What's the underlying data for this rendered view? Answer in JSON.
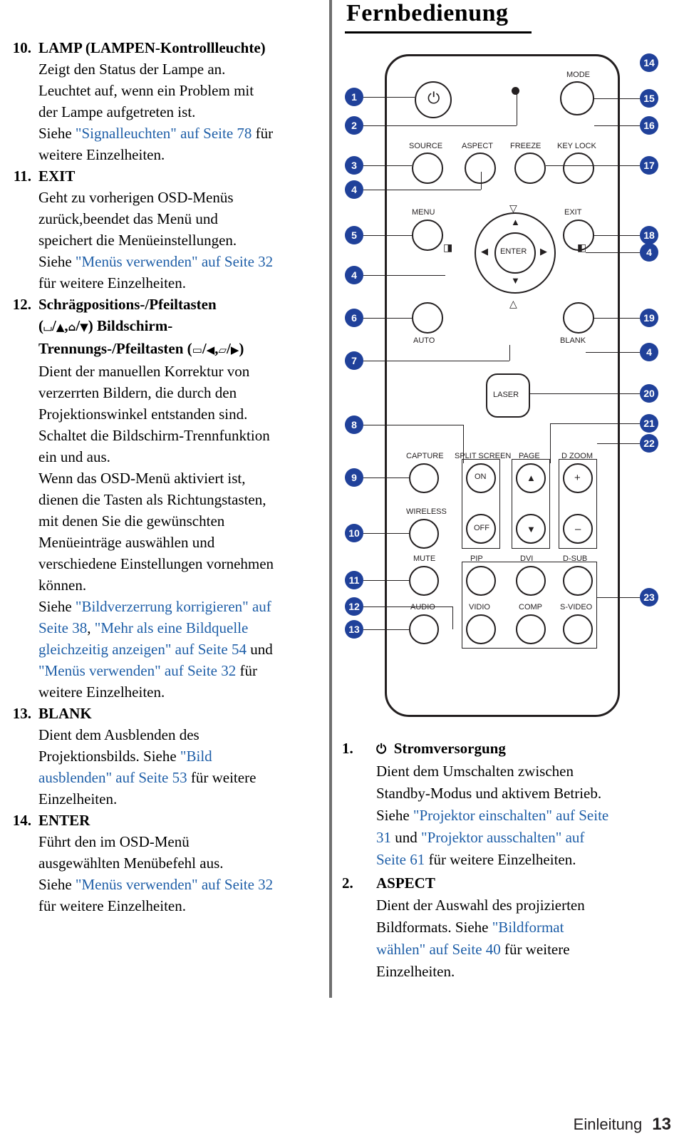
{
  "left_items": [
    {
      "num": "10.",
      "head": "LAMP (LAMPEN-Kontrollleuchte)",
      "lines": [
        {
          "text": "Zeigt den Status der Lampe an."
        },
        {
          "text": "Leuchtet auf, wenn ein Problem mit"
        },
        {
          "text": "der Lampe aufgetreten ist."
        },
        {
          "pre": "Siehe ",
          "link": "\"Signalleuchten\" auf Seite 78",
          "post": " für"
        },
        {
          "text": "weitere Einzelheiten."
        }
      ]
    },
    {
      "num": "11.",
      "head": "EXIT",
      "lines": [
        {
          "text": "Geht zu vorherigen OSD-Menüs"
        },
        {
          "text": "zurück,beendet das Menü und"
        },
        {
          "text": "speichert die Menüeinstellungen."
        },
        {
          "pre": "Siehe ",
          "link": "\"Menüs verwenden\" auf Seite 32",
          "post": ""
        },
        {
          "text": "für weitere Einzelheiten."
        }
      ]
    },
    {
      "num": "12.",
      "head": "Schrägpositions-/Pfeiltasten",
      "head2": "Bildschirm-Trennungs-/Pfeiltasten",
      "lines": [
        {
          "text": "Dient der manuellen Korrektur von"
        },
        {
          "text": "verzerrten Bildern, die durch den"
        },
        {
          "text": "Projektionswinkel entstanden sind."
        },
        {
          "text": "Schaltet die Bildschirm-Trennfunktion"
        },
        {
          "text": "ein und aus."
        },
        {
          "text": "Wenn das OSD-Menü aktiviert ist,"
        },
        {
          "text": "dienen die Tasten als Richtungstasten,"
        },
        {
          "text": "mit denen Sie die gewünschten"
        },
        {
          "text": "Menüeinträge auswählen und"
        },
        {
          "text": "verschiedene Einstellungen vornehmen"
        },
        {
          "text": "können."
        }
      ]
    },
    {
      "num": "13.",
      "head": "BLANK",
      "lines": [
        {
          "text": "Dient dem Ausblenden des"
        },
        {
          "pre": "Projektionsbilds. Siehe ",
          "link": "\"Bild",
          "post": ""
        },
        {
          "link2": "ausblenden\" auf Seite 53",
          "post2": " für weitere"
        },
        {
          "text": "Einzelheiten."
        }
      ]
    },
    {
      "num": "14.",
      "head": "ENTER",
      "lines": [
        {
          "text": "Führt den im OSD-Menü"
        },
        {
          "text": "ausgewählten Menübefehl aus."
        },
        {
          "pre": "Siehe ",
          "link": "\"Menüs verwenden\" auf Seite 32",
          "post": ""
        },
        {
          "text": "für weitere Einzelheiten."
        }
      ]
    }
  ],
  "item12": {
    "sym_line_1_a": "(",
    "sym_line_1_b": "/",
    "sym_line_1_c": ",",
    "sym_line_1_d": "/",
    "sym_line_1_e": ") Bildschirm-",
    "sym_line_2_a": "Trennungs-/Pfeiltasten (",
    "sym_line_2_b": "/",
    "sym_line_2_c": ",",
    "sym_line_2_d": "/",
    "sym_line_2_e": ")"
  },
  "item12_refs": {
    "l1_pre": "Siehe ",
    "l1_link": "\"Bildverzerrung korrigieren\" auf",
    "l2_a": "Seite 38",
    "l2_b": ", ",
    "l2_link": "\"Mehr als eine Bildquelle",
    "l3_link": "gleichzeitig anzeigen\" auf Seite 54",
    "l3_post": " und",
    "l4_link": "\"Menüs verwenden\" auf Seite 32",
    "l4_post": " für",
    "l5": "weitere Einzelheiten."
  },
  "right": {
    "title": "Fernbedienung",
    "items": [
      {
        "num": "1.",
        "head": "Stromversorgung",
        "head_icon": "power-icon",
        "lines": [
          {
            "text": "Dient dem Umschalten zwischen"
          },
          {
            "text": "Standby-Modus und aktivem Betrieb."
          },
          {
            "pre": "Siehe ",
            "link": "\"Projektor einschalten\" auf Seite"
          },
          {
            "a": "31",
            "b": " und ",
            "link": "\"Projektor ausschalten\" auf"
          },
          {
            "link2": "Seite 61",
            "post2": " für weitere Einzelheiten."
          }
        ]
      },
      {
        "num": "2.",
        "head": "ASPECT",
        "lines": [
          {
            "text": "Dient der Auswahl des projizierten"
          },
          {
            "pre": "Bildformats. Siehe ",
            "link": "\"Bildformat"
          },
          {
            "link2": "wählen\" auf Seite 40",
            "post2": " für weitere"
          },
          {
            "text": "Einzelheiten."
          }
        ]
      }
    ]
  },
  "remote": {
    "labels": {
      "mode": "MODE",
      "source": "SOURCE",
      "aspect": "ASPECT",
      "freeze": "FREEZE",
      "keylock": "KEY LOCK",
      "menu": "MENU",
      "exit": "EXIT",
      "enter": "ENTER",
      "auto": "AUTO",
      "blank": "BLANK",
      "laser": "LASER",
      "capture": "CAPTURE",
      "splitscreen": "SPLIT SCREEN",
      "page": "PAGE",
      "dzoom": "D ZOOM",
      "on": "ON",
      "off": "OFF",
      "plus": "+",
      "minus": "–",
      "wireless": "WIRELESS",
      "mute": "MUTE",
      "pip": "PIP",
      "dvi": "DVI",
      "dsub": "D-SUB",
      "audio": "AUDIO",
      "vidio": "VIDIO",
      "comp": "COMP",
      "svideo": "S-VIDEO"
    },
    "callouts_left": [
      "1",
      "2",
      "3",
      "4",
      "5",
      "4",
      "6",
      "7",
      "8",
      "9",
      "10",
      "11",
      "12",
      "13"
    ],
    "callouts_right": [
      "14",
      "15",
      "16",
      "17",
      "18",
      "4",
      "19",
      "4",
      "20",
      "21",
      "22",
      "23"
    ]
  },
  "footer": {
    "section": "Einleitung",
    "page": "13"
  }
}
